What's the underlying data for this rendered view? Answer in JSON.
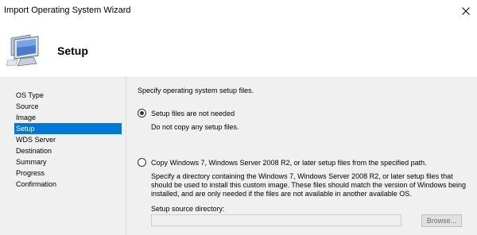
{
  "window": {
    "title": "Import Operating System Wizard"
  },
  "header": {
    "title": "Setup",
    "icon": "computer-monitor-icon"
  },
  "sidebar": {
    "items": [
      {
        "label": "OS Type",
        "active": false
      },
      {
        "label": "Source",
        "active": false
      },
      {
        "label": "Image",
        "active": false
      },
      {
        "label": "Setup",
        "active": true
      },
      {
        "label": "WDS Server",
        "active": false
      },
      {
        "label": "Destination",
        "active": false
      },
      {
        "label": "Summary",
        "active": false
      },
      {
        "label": "Progress",
        "active": false
      },
      {
        "label": "Confirmation",
        "active": false
      }
    ]
  },
  "main": {
    "instruction": "Specify operating system setup files.",
    "option1": {
      "label": "Setup files are not needed",
      "subtext": "Do not copy any setup files.",
      "checked": true
    },
    "option2": {
      "label": "Copy Windows 7, Windows Server 2008 R2, or later setup files from the specified path.",
      "checked": false,
      "desc_line1": "Specify a directory containing the Windows 7, Windows Server 2008 R2, or later setup files that",
      "desc_line2": "should be used to install this custom image.  These files should match the version of Windows being",
      "desc_line3": "installed, and are only needed if the files are not available in another available OS."
    },
    "directory": {
      "label": "Setup source directory:",
      "value": "",
      "browse_label": "Browse..."
    }
  },
  "colors": {
    "selection": "#0078d7",
    "panel_background": "#f0f0f0"
  }
}
